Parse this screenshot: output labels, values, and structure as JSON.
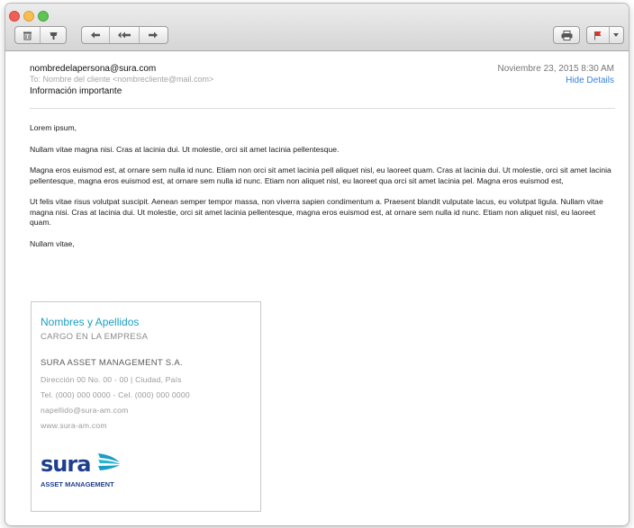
{
  "email": {
    "from": "nombredelapersona@sura.com",
    "to": "To: Nombre del cliente <nombrecliente@mail.com>",
    "subject": "Información importante",
    "date": "Noviembre 23, 2015 8:30 AM",
    "hide_details": "Hide Details"
  },
  "body": {
    "paragraphs": [
      "Lorem ipsum,",
      "Nullam vitae magna nisi. Cras at lacinia dui. Ut molestie, orci sit amet lacinia pellentesque.",
      "Magna eros euismod est, at ornare sem nulla id nunc. Etiam non orci sit amet lacinia pell aliquet nisl, eu laoreet quam. Cras at lacinia dui. Ut molestie, orci sit amet lacinia pellentesque, magna eros euismod est, at ornare sem nulla id nunc. Etiam non aliquet nisl, eu laoreet qua orci sit amet lacinia pel. Magna eros euismod est,",
      "Ut felis vitae risus volutpat suscipit. Aenean semper tempor massa, non viverra sapien condimentum a. Praesent blandit vulputate lacus, eu volutpat ligula. Nullam vitae magna nisi. Cras at lacinia dui. Ut molestie, orci sit amet lacinia pellentesque, magna eros euismod est, at ornare sem nulla id nunc. Etiam non aliquet nisl, eu laoreet quam.",
      "Nullam vitae,"
    ]
  },
  "signature": {
    "name": "Nombres y Apellidos",
    "cargo": "CARGO EN LA EMPRESA",
    "company": "SURA ASSET MANAGEMENT S.A.",
    "address": "Dirección 00 No. 00 - 00 | Ciudad, País",
    "phone": "Tel. (000) 000 0000 - Cel. (000) 000 0000",
    "email": "napellido@sura-am.com",
    "web": "www.sura-am.com",
    "logo_word": "sura",
    "logo_sub": "ASSET MANAGEMENT"
  },
  "toolbar": {
    "icons": [
      "trash-icon",
      "junk-icon",
      "reply-icon",
      "reply-all-icon",
      "forward-icon",
      "print-icon",
      "flag-icon",
      "dropdown-icon"
    ]
  },
  "colors": {
    "accent": "#1a9fc4",
    "brand_blue": "#1f3f8f",
    "link": "#3b83d8"
  }
}
